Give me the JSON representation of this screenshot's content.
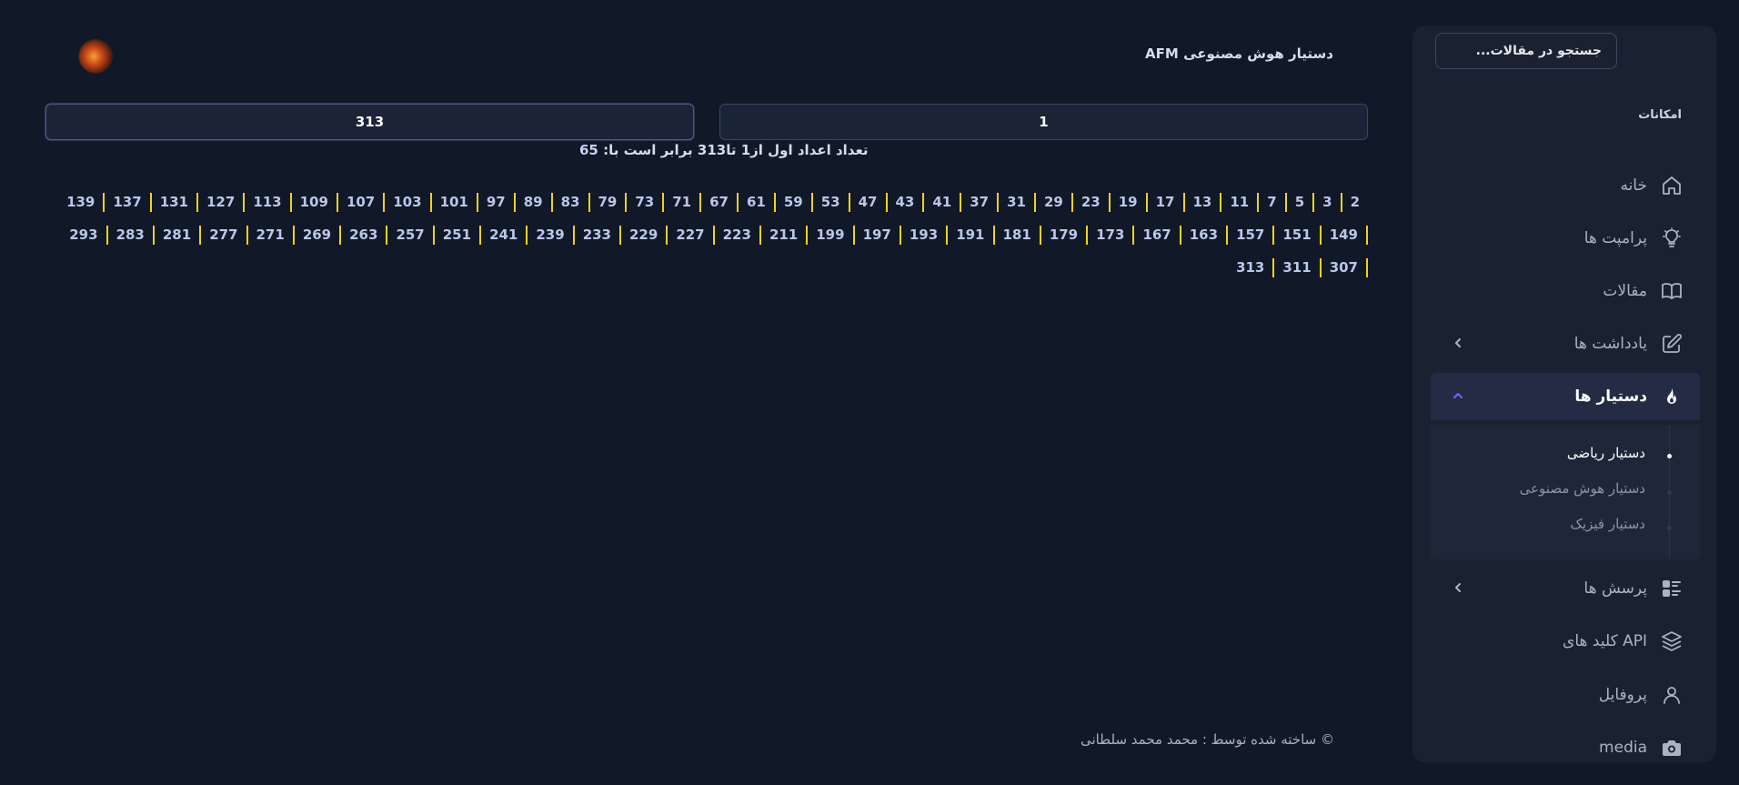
{
  "sidebar": {
    "search_placeholder": "جستجو در مقالات...",
    "section_title": "امکانات",
    "items": [
      {
        "label": "خانه",
        "icon": "home-icon"
      },
      {
        "label": "پرامپت ها",
        "icon": "lightbulb-icon"
      },
      {
        "label": "مقالات",
        "icon": "book-icon"
      },
      {
        "label": "یادداشت ها",
        "icon": "edit-icon"
      },
      {
        "label": "دستیار ها",
        "icon": "flame-icon"
      },
      {
        "label": "پرسش ها",
        "icon": "list-icon"
      },
      {
        "label": "کلید های API",
        "icon": "layers-icon"
      },
      {
        "label": "پروفایل",
        "icon": "user-icon"
      },
      {
        "label": "media",
        "icon": "camera-icon"
      }
    ],
    "submenu": [
      {
        "label": "دستیار ریاضی",
        "active": true
      },
      {
        "label": "دستیار هوش مصنوعی",
        "active": false
      },
      {
        "label": "دستیار فیزیک",
        "active": false
      }
    ]
  },
  "header": {
    "title": "دستیار هوش مصنوعی AFM"
  },
  "inputs": {
    "from_value": "1",
    "to_value": "313"
  },
  "result": {
    "text": "تعداد اعداد اول از1 تا313 برابر است با:",
    "count": "65"
  },
  "primes": [
    "2",
    "3",
    "5",
    "7",
    "11",
    "13",
    "17",
    "19",
    "23",
    "29",
    "31",
    "37",
    "41",
    "43",
    "47",
    "53",
    "59",
    "61",
    "67",
    "71",
    "73",
    "79",
    "83",
    "89",
    "97",
    "101",
    "103",
    "107",
    "109",
    "113",
    "127",
    "131",
    "137",
    "139",
    "149",
    "151",
    "157",
    "163",
    "167",
    "173",
    "179",
    "181",
    "191",
    "193",
    "197",
    "199",
    "211",
    "223",
    "227",
    "229",
    "233",
    "239",
    "241",
    "251",
    "257",
    "263",
    "269",
    "271",
    "277",
    "281",
    "283",
    "293",
    "307",
    "311",
    "313"
  ],
  "footer": {
    "text": "© ساخته شده توسط : محمد محمد سلطانی"
  },
  "colors": {
    "background": "#111827",
    "sidebar": "#1a2232",
    "accent": "#7c5cff",
    "separator": "#f2d31b"
  }
}
